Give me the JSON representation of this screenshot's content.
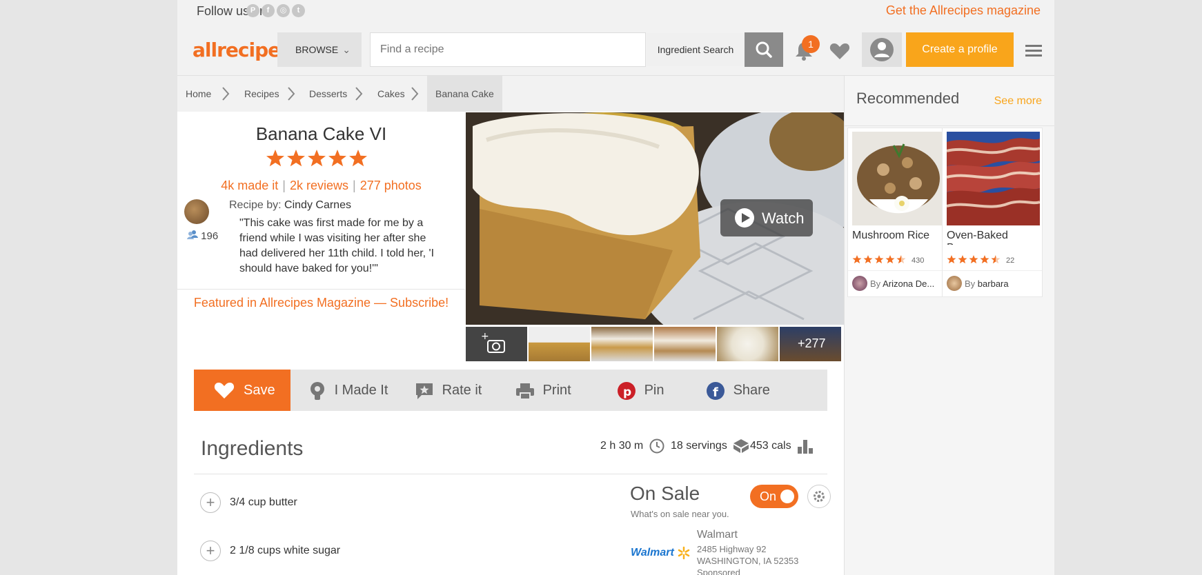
{
  "top_bar": {
    "follow_label": "Follow us on:",
    "social_icons": [
      "pinterest-icon",
      "facebook-icon",
      "instagram-icon",
      "twitter-icon"
    ],
    "magazine_link": "Get the Allrecipes magazine"
  },
  "header": {
    "logo": "allrecipes",
    "browse_label": "BROWSE",
    "search_placeholder": "Find a recipe",
    "ingredient_search_label": "Ingredient Search",
    "notification_count": "1",
    "create_profile_label": "Create a profile"
  },
  "breadcrumb": [
    "Home",
    "Recipes",
    "Desserts",
    "Cakes",
    "Banana Cake"
  ],
  "recipe": {
    "title": "Banana Cake VI",
    "rating_stars": 5,
    "made_it": "4k made it",
    "reviews": "2k reviews",
    "photos": "277 photos",
    "recipe_by_label": "Recipe by:",
    "author": "Cindy Carnes",
    "followers": "196",
    "description": "\"This cake was first made for me by a friend while I was visiting her after she had delivered her 11th child. I told her, 'I should have baked for you!'\"",
    "featured": "Featured in Allrecipes Magazine — Subscribe!",
    "watch_label": "Watch",
    "more_photos": "+277"
  },
  "actions": {
    "save": "Save",
    "made_it": "I Made It",
    "rate": "Rate it",
    "print": "Print",
    "pin": "Pin",
    "share": "Share"
  },
  "ingredients": {
    "title": "Ingredients",
    "time": "2 h 30 m",
    "servings": "18 servings",
    "calories": "453 cals",
    "items": [
      "3/4 cup butter",
      "2 1/8 cups white sugar"
    ]
  },
  "on_sale": {
    "title": "On Sale",
    "subtitle": "What's on sale near you.",
    "toggle_label": "On",
    "store_logo": "Walmart",
    "store_name": "Walmart",
    "address_line1": "2485 Highway 92",
    "address_line2": "WASHINGTON, IA 52353",
    "sponsored": "Sponsored"
  },
  "sidebar": {
    "title": "Recommended",
    "see_more": "See more",
    "cards": [
      {
        "name": "Mushroom Rice",
        "rating": 4.5,
        "count": "430",
        "by_label": "By",
        "author": "Arizona De..."
      },
      {
        "name": "Oven-Baked Bacon",
        "rating": 4.5,
        "count": "22",
        "by_label": "By",
        "author": "barbara"
      }
    ]
  },
  "colors": {
    "brand_orange": "#f26f22",
    "cta_yellow": "#f9a51b",
    "pinterest_red": "#cb2027",
    "facebook_blue": "#3b5998",
    "walmart_blue": "#1a75cf"
  }
}
